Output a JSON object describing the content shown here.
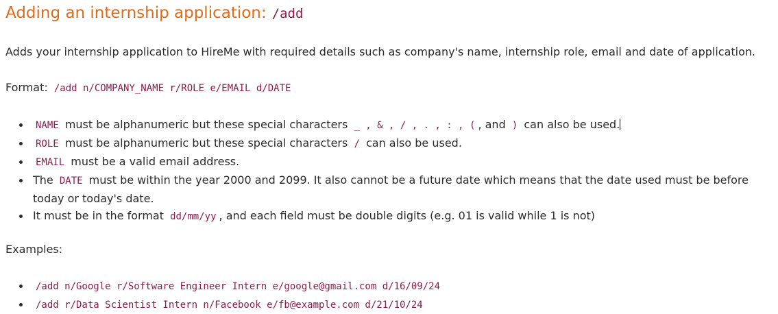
{
  "heading": {
    "title": "Adding an internship application:",
    "command": "/add"
  },
  "description": "Adds your internship application to HireMe with required details such as company's name, internship role, email and date of application.",
  "format": {
    "label": "Format:",
    "code": "/add n/COMPANY_NAME r/ROLE e/EMAIL d/DATE"
  },
  "rules": {
    "name": {
      "code": "NAME",
      "text1": "must be alphanumeric but these special characters",
      "chars": "_ , & , / , . , : , (",
      "and": ", and",
      "last_char": ")",
      "text2": "can also be used."
    },
    "role": {
      "code": "ROLE",
      "text1": "must be alphanumeric but these special characters",
      "chars": "/",
      "text2": "can also be used."
    },
    "email": {
      "code": "EMAIL",
      "text": "must be a valid email address."
    },
    "date": {
      "prefix": "The",
      "code": "DATE",
      "text": "must be within the year 2000 and 2099. It also cannot be a future date which means that the date used must be before today or today's date."
    },
    "date_format": {
      "prefix": "It must be in the format",
      "code": "dd/mm/yy",
      "text": ", and each field must be double digits (e.g. 01 is valid while 1 is not)"
    }
  },
  "examples": {
    "label": "Examples:",
    "items": [
      "/add n/Google r/Software Engineer Intern e/google@gmail.com d/16/09/24",
      "/add r/Data Scientist Intern n/Facebook e/fb@example.com d/21/10/24"
    ]
  }
}
